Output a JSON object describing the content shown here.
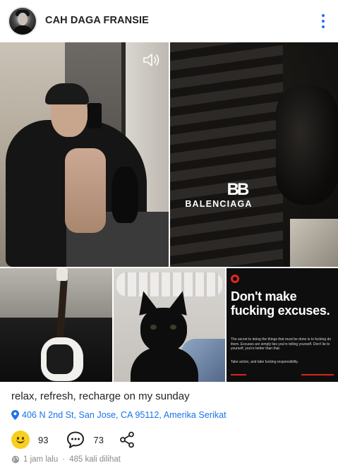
{
  "post": {
    "author": "CAH DAGA FRANSIE",
    "caption": "relax, refresh, recharge on my sunday",
    "location": "406 N 2nd St, San Jose, CA 95112, Amerika Serikat",
    "reactions": "93",
    "comments": "73",
    "time_ago": "1 jam lalu",
    "views": "485 kali dilihat"
  },
  "photos": {
    "brand_mark": "BB",
    "brand_name": "BALENCIAGA",
    "poster_headline": "Don't make fucking excuses.",
    "poster_body": "The secret to doing the things that must be done is to fucking do them. Excuses are simply lies you're telling yourself. Don't lie to yourself, you're better than that.",
    "poster_footer": "Take action, and take fucking responsibility."
  },
  "colors": {
    "accent_blue": "#1a73e8",
    "reaction_yellow": "#f7cf1d",
    "poster_red": "#e0281e"
  },
  "icons": [
    "more-vertical-icon",
    "sound-icon",
    "location-pin-icon",
    "smile-reaction-icon",
    "comment-icon",
    "share-icon",
    "globe-icon"
  ]
}
